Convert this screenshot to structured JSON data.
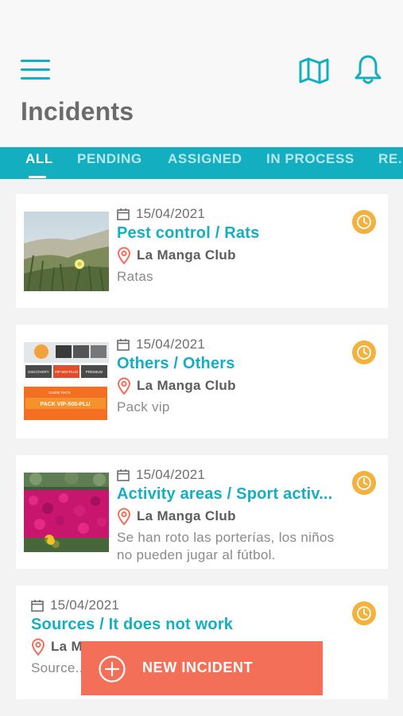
{
  "header": {
    "title": "Incidents",
    "menu_icon": "hamburger-menu-icon",
    "map_icon": "map-icon",
    "notifications_icon": "bell-icon",
    "accent_color": "#13aec0"
  },
  "tabs": [
    {
      "label": "ALL",
      "active": true
    },
    {
      "label": "PENDING",
      "active": false
    },
    {
      "label": "ASSIGNED",
      "active": false
    },
    {
      "label": "IN PROCESS",
      "active": false
    },
    {
      "label": "RE...",
      "active": false
    }
  ],
  "incidents": [
    {
      "date": "15/04/2021",
      "title": "Pest control / Rats",
      "location": "La Manga Club",
      "description": "Ratas",
      "status_icon": "clock-icon",
      "thumbnail": "dune-plants-photo"
    },
    {
      "date": "15/04/2021",
      "title": "Others / Others",
      "location": "La Manga Club",
      "description": "Pack vip",
      "status_icon": "clock-icon",
      "thumbnail": "pack-vip-flyer",
      "thumbnail_text": {
        "tier1": "DISCOVERY",
        "tier2": "VIP-500-PLUS",
        "tier3": "PREMIUM",
        "tag": "GUIDE PACK",
        "banner": "PACK VIP-500-PLU"
      }
    },
    {
      "date": "15/04/2021",
      "title": "Activity areas / Sport activ...",
      "location": "La Manga Club",
      "description": "Se han roto las porterías, los niños no pueden jugar al fútbol.",
      "status_icon": "clock-icon",
      "thumbnail": "pink-flowers-photo"
    },
    {
      "date": "15/04/2021",
      "title": "Sources / It does not work",
      "location": "La M...",
      "description": "Source...",
      "status_icon": "clock-icon"
    }
  ],
  "fab": {
    "label": "NEW INCIDENT",
    "icon": "plus-circle-icon",
    "color": "#f36f57"
  },
  "colors": {
    "title": "#14afc2",
    "status_badge": "#f5b13d"
  }
}
